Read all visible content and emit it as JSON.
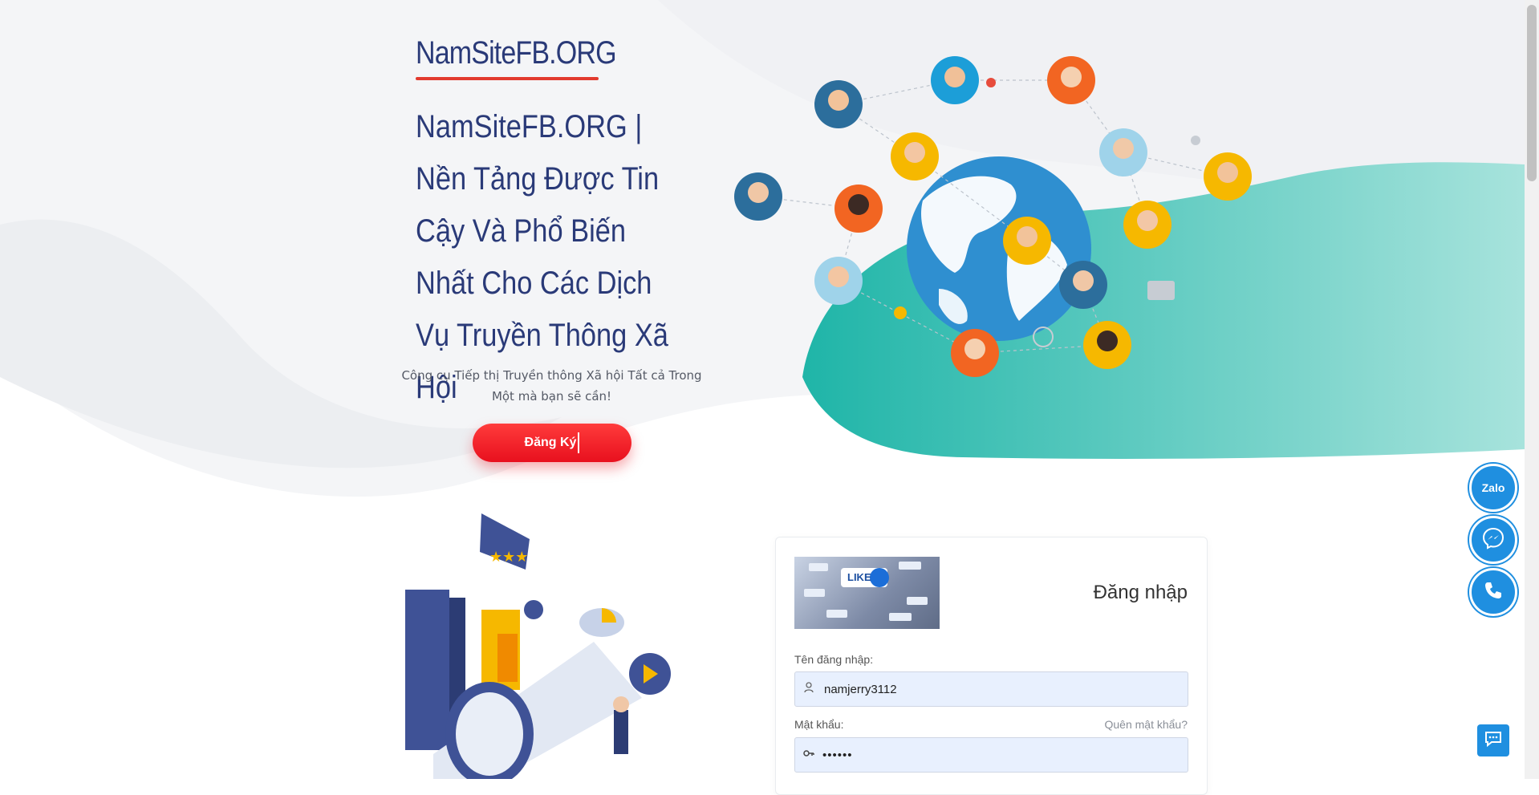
{
  "brand": {
    "logo_text": "NamSiteFB.ORG",
    "accent_color": "#e23a2e",
    "title_color": "#2a3a78"
  },
  "hero": {
    "title": "NamSiteFB.ORG | Nền Tảng Được Tin Cậy Và Phổ Biến Nhất Cho Các Dịch Vụ Truyền Thông Xã Hội",
    "subtitle": "Công cụ Tiếp thị Truyền thông Xã hội Tất cả Trong Một mà bạn sẽ cần!",
    "cta_label": "Đăng Ký",
    "cta_color": "#ff2a2a"
  },
  "login": {
    "title": "Đăng nhập",
    "username_label": "Tên đăng nhập:",
    "username_value": "namjerry3112",
    "password_label": "Mật khẩu:",
    "password_value": "••••••",
    "forgot_label": "Quên mật khẩu?",
    "thumb_text": "LIKE"
  },
  "floating": {
    "zalo_label": "Zalo",
    "messenger_icon": "messenger-icon",
    "phone_icon": "phone-icon",
    "chat_icon": "chat-icon",
    "button_color": "#1f8fe0"
  }
}
